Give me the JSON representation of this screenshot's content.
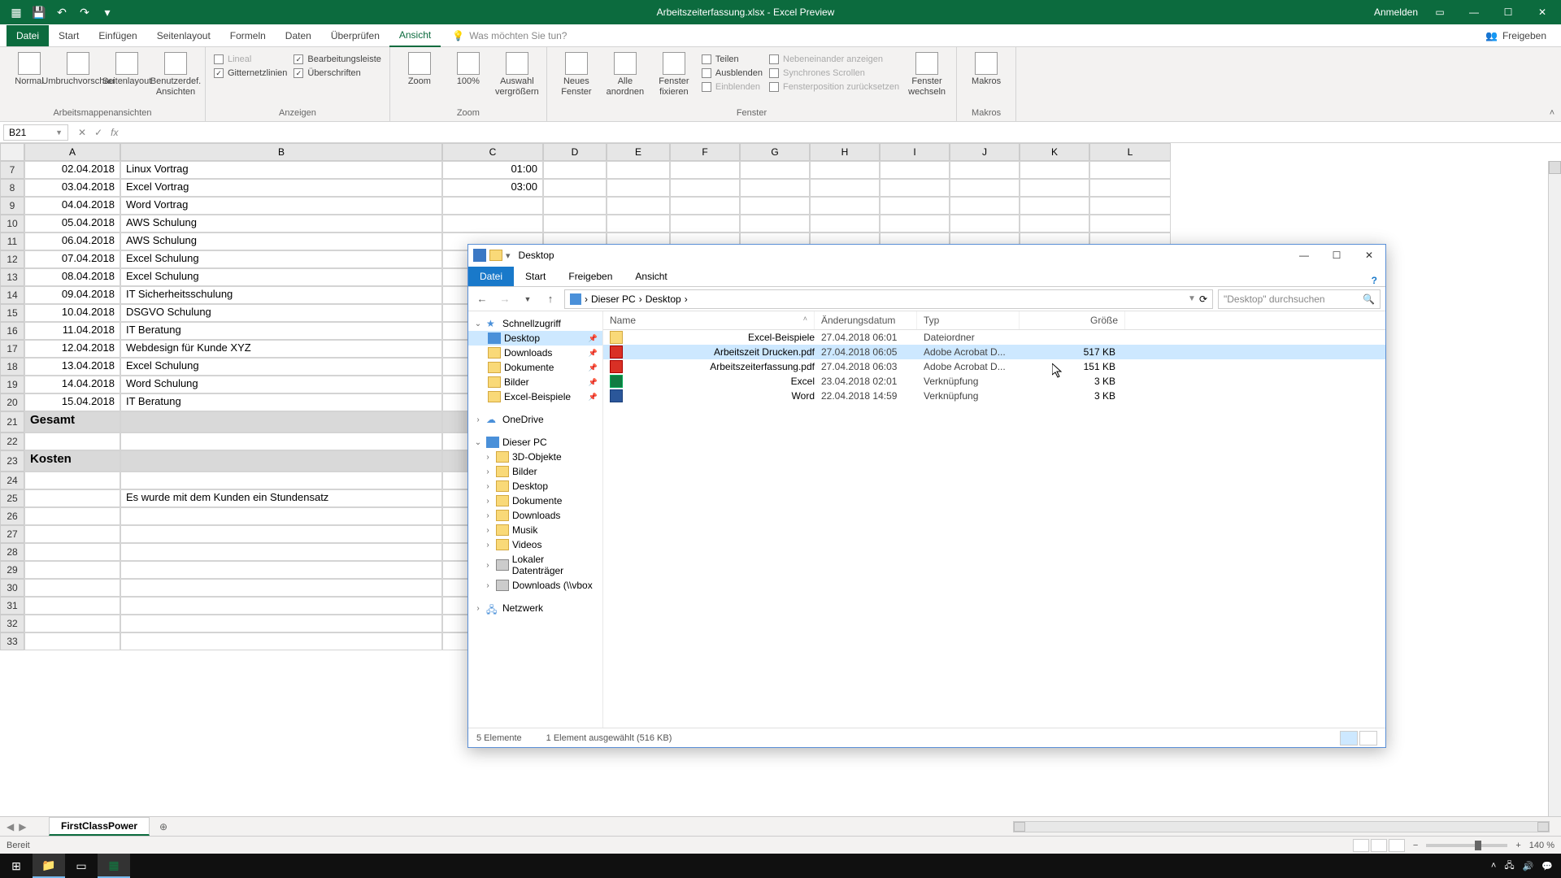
{
  "excel": {
    "title": "Arbeitszeiterfassung.xlsx - Excel Preview",
    "signin": "Anmelden",
    "tabs": [
      "Datei",
      "Start",
      "Einfügen",
      "Seitenlayout",
      "Formeln",
      "Daten",
      "Überprüfen",
      "Ansicht"
    ],
    "active_tab": "Ansicht",
    "tellme": "Was möchten Sie tun?",
    "share": "Freigeben",
    "ribbon": {
      "g1": {
        "label": "Arbeitsmappenansichten",
        "btns": [
          "Normal",
          "Umbruchvorschau",
          "Seitenlayout",
          "Benutzerdef. Ansichten"
        ]
      },
      "g2": {
        "label": "Anzeigen",
        "items": [
          "Lineal",
          "Bearbeitungsleiste",
          "Gitternetzlinien",
          "Überschriften"
        ]
      },
      "g3": {
        "label": "Zoom",
        "btns": [
          "Zoom",
          "100%",
          "Auswahl vergrößern"
        ]
      },
      "g4": {
        "label": "Fenster",
        "btns": [
          "Neues Fenster",
          "Alle anordnen",
          "Fenster fixieren"
        ],
        "side": [
          "Teilen",
          "Ausblenden",
          "Einblenden"
        ],
        "side2": [
          "Nebeneinander anzeigen",
          "Synchrones Scrollen",
          "Fensterposition zurücksetzen"
        ],
        "btns2": [
          "Fenster wechseln"
        ]
      },
      "g5": {
        "label": "Makros",
        "btn": "Makros"
      }
    },
    "name_box": "B21",
    "columns": [
      "A",
      "B",
      "C",
      "D",
      "E",
      "F",
      "G",
      "H",
      "I",
      "J",
      "K",
      "L"
    ],
    "rows": [
      {
        "n": "7",
        "a": "02.04.2018",
        "b": "Linux Vortrag",
        "c": "01:00"
      },
      {
        "n": "8",
        "a": "03.04.2018",
        "b": "Excel Vortrag",
        "c": "03:00"
      },
      {
        "n": "9",
        "a": "04.04.2018",
        "b": "Word Vortrag",
        "c": ""
      },
      {
        "n": "10",
        "a": "05.04.2018",
        "b": "AWS Schulung",
        "c": ""
      },
      {
        "n": "11",
        "a": "06.04.2018",
        "b": "AWS Schulung",
        "c": ""
      },
      {
        "n": "12",
        "a": "07.04.2018",
        "b": "Excel Schulung",
        "c": ""
      },
      {
        "n": "13",
        "a": "08.04.2018",
        "b": "Excel Schulung",
        "c": ""
      },
      {
        "n": "14",
        "a": "09.04.2018",
        "b": "IT Sicherheitsschulung",
        "c": ""
      },
      {
        "n": "15",
        "a": "10.04.2018",
        "b": "DSGVO Schulung",
        "c": ""
      },
      {
        "n": "16",
        "a": "11.04.2018",
        "b": "IT Beratung",
        "c": ""
      },
      {
        "n": "17",
        "a": "12.04.2018",
        "b": "Webdesign für Kunde XYZ",
        "c": ""
      },
      {
        "n": "18",
        "a": "13.04.2018",
        "b": "Excel Schulung",
        "c": ""
      },
      {
        "n": "19",
        "a": "14.04.2018",
        "b": "Word Schulung",
        "c": ""
      },
      {
        "n": "20",
        "a": "15.04.2018",
        "b": "IT Beratung",
        "c": ""
      }
    ],
    "row21": {
      "n": "21",
      "a": "Gesamt"
    },
    "row22": {
      "n": "22"
    },
    "row23": {
      "n": "23",
      "a": "Kosten"
    },
    "row24": {
      "n": "24"
    },
    "row25": {
      "n": "25",
      "b": "Es wurde mit dem Kunden ein Stundensatz"
    },
    "empty_rows": [
      "26",
      "27",
      "28",
      "29",
      "30",
      "31",
      "32",
      "33"
    ],
    "sheet_tab": "FirstClassPower",
    "status": "Bereit",
    "zoom": "140 %"
  },
  "explorer": {
    "title": "Desktop",
    "tabs": [
      "Datei",
      "Start",
      "Freigeben",
      "Ansicht"
    ],
    "path": [
      "Dieser PC",
      "Desktop"
    ],
    "search_ph": "\"Desktop\" durchsuchen",
    "tree": {
      "quick": "Schnellzugriff",
      "quick_items": [
        "Desktop",
        "Downloads",
        "Dokumente",
        "Bilder",
        "Excel-Beispiele"
      ],
      "onedrive": "OneDrive",
      "thispc": "Dieser PC",
      "pc_items": [
        "3D-Objekte",
        "Bilder",
        "Desktop",
        "Dokumente",
        "Downloads",
        "Musik",
        "Videos",
        "Lokaler Datenträger",
        "Downloads (\\\\vbox"
      ],
      "network": "Netzwerk"
    },
    "headers": {
      "name": "Name",
      "date": "Änderungsdatum",
      "type": "Typ",
      "size": "Größe"
    },
    "files": [
      {
        "name": "Excel-Beispiele",
        "date": "27.04.2018 06:01",
        "type": "Dateiordner",
        "size": "",
        "icon": "folder"
      },
      {
        "name": "Arbeitszeit Drucken.pdf",
        "date": "27.04.2018 06:05",
        "type": "Adobe Acrobat D...",
        "size": "517 KB",
        "icon": "pdf",
        "selected": true
      },
      {
        "name": "Arbeitszeiterfassung.pdf",
        "date": "27.04.2018 06:03",
        "type": "Adobe Acrobat D...",
        "size": "151 KB",
        "icon": "pdf"
      },
      {
        "name": "Excel",
        "date": "23.04.2018 02:01",
        "type": "Verknüpfung",
        "size": "3 KB",
        "icon": "excel"
      },
      {
        "name": "Word",
        "date": "22.04.2018 14:59",
        "type": "Verknüpfung",
        "size": "3 KB",
        "icon": "word"
      }
    ],
    "status": {
      "count": "5 Elemente",
      "sel": "1 Element ausgewählt (516 KB)"
    }
  }
}
